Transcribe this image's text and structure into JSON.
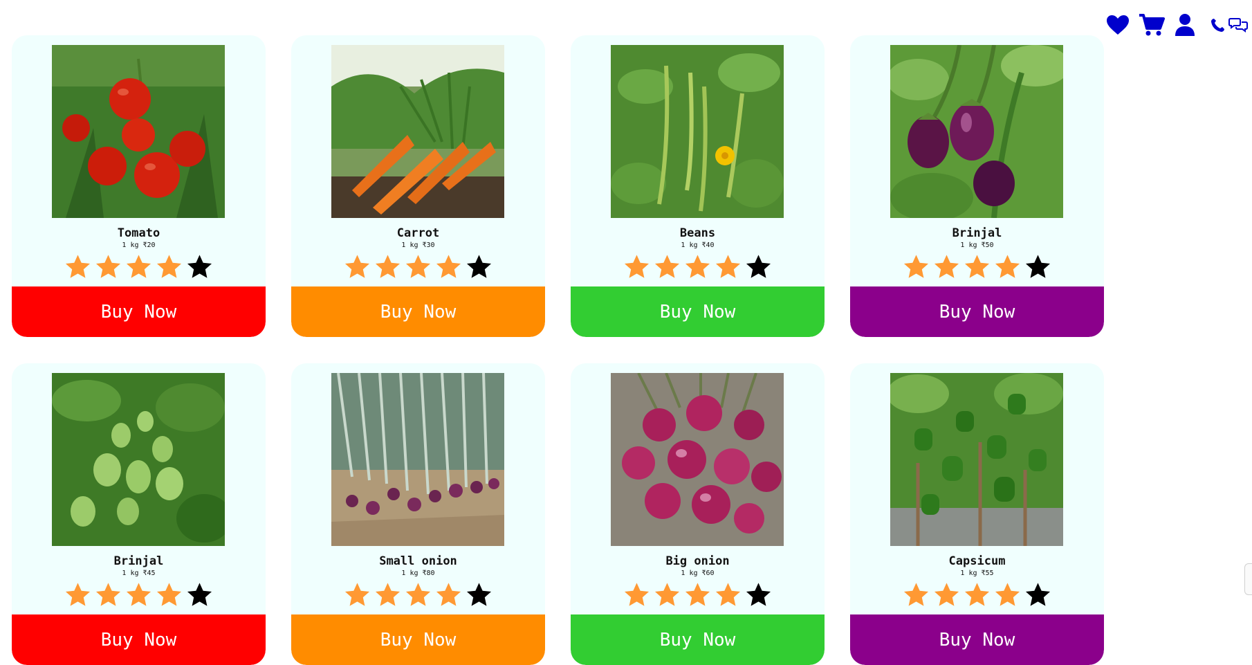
{
  "colors": {
    "icon_blue": "#0000cc",
    "card_bg": "#f0fffe",
    "star_on": "#ff9933",
    "star_off": "#000000"
  },
  "header": {
    "icons": [
      "heart-icon",
      "cart-icon",
      "user-icon",
      "phone-icon",
      "chat-icon"
    ]
  },
  "products": [
    {
      "name": "Tomato",
      "price": "1 kg ₹20",
      "rating": 4,
      "max_rating": 5,
      "button": "Buy Now",
      "button_color": "#ff0000",
      "image": "tomato-photo"
    },
    {
      "name": "Carrot",
      "price": "1 kg ₹30",
      "rating": 4,
      "max_rating": 5,
      "button": "Buy Now",
      "button_color": "#ff8c00",
      "image": "carrot-photo"
    },
    {
      "name": "Beans",
      "price": "1 kg ₹40",
      "rating": 4,
      "max_rating": 5,
      "button": "Buy Now",
      "button_color": "#32cd32",
      "image": "beans-photo"
    },
    {
      "name": "Brinjal",
      "price": "1 kg ₹50",
      "rating": 4,
      "max_rating": 5,
      "button": "Buy Now",
      "button_color": "#8b008b",
      "image": "purple-brinjal-photo"
    },
    {
      "name": "Brinjal",
      "price": "1 kg ₹45",
      "rating": 4,
      "max_rating": 5,
      "button": "Buy Now",
      "button_color": "#ff0000",
      "image": "green-brinjal-photo"
    },
    {
      "name": "Small onion",
      "price": "1 kg ₹80",
      "rating": 4,
      "max_rating": 5,
      "button": "Buy Now",
      "button_color": "#ff8c00",
      "image": "small-onion-photo"
    },
    {
      "name": "Big onion",
      "price": "1 kg ₹60",
      "rating": 4,
      "max_rating": 5,
      "button": "Buy Now",
      "button_color": "#32cd32",
      "image": "big-onion-photo"
    },
    {
      "name": "Capsicum",
      "price": "1 kg ₹55",
      "rating": 4,
      "max_rating": 5,
      "button": "Buy Now",
      "button_color": "#8b008b",
      "image": "capsicum-photo"
    }
  ]
}
